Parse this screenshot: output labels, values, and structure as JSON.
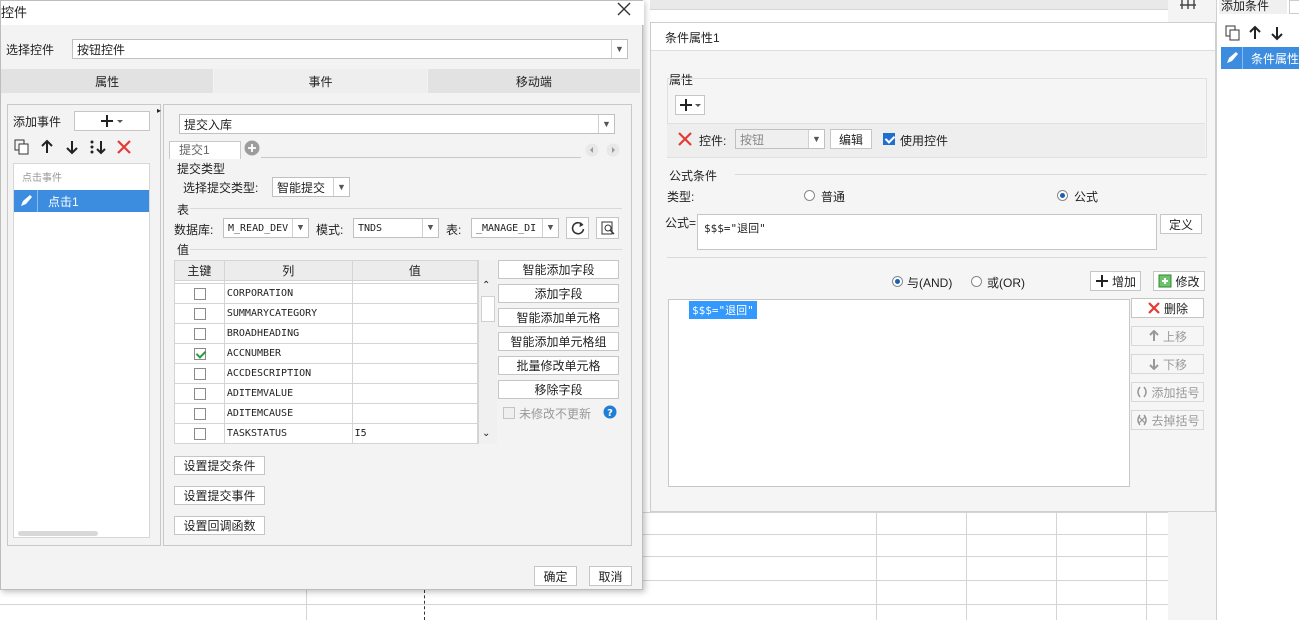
{
  "main_dialog": {
    "title": "控件",
    "select_label": "选择控件",
    "select_value": "按钮控件",
    "tabs": [
      "属性",
      "事件",
      "移动端"
    ],
    "active_tab": 1,
    "add_event_label": "添加事件",
    "event_group_label": "点击事件",
    "event_item": "点击1",
    "action_select": "提交入库",
    "submit_tab": "提交1",
    "submit_type_section": "提交类型",
    "submit_type_label": "选择提交类型:",
    "submit_type_value": "智能提交",
    "table_section": "表",
    "db_label": "数据库:",
    "db_value": "M_READ_DEV",
    "schema_label": "模式:",
    "schema_value": "TNDS",
    "table_label": "表:",
    "table_value": "_MANAGE_DI",
    "value_section": "值",
    "columns": [
      "主键",
      "列",
      "值"
    ],
    "rows": [
      {
        "key": false,
        "col": "CORPORATION",
        "val": ""
      },
      {
        "key": false,
        "col": "SUMMARYCATEGORY",
        "val": ""
      },
      {
        "key": false,
        "col": "BROADHEADING",
        "val": ""
      },
      {
        "key": true,
        "col": "ACCNUMBER",
        "val": ""
      },
      {
        "key": false,
        "col": "ACCDESCRIPTION",
        "val": ""
      },
      {
        "key": false,
        "col": "ADITEMVALUE",
        "val": ""
      },
      {
        "key": false,
        "col": "ADITEMCAUSE",
        "val": ""
      },
      {
        "key": false,
        "col": "TASKSTATUS",
        "val": "I5"
      }
    ],
    "side_buttons": [
      "智能添加字段",
      "添加字段",
      "智能添加单元格",
      "智能添加单元格组",
      "批量修改单元格",
      "移除字段"
    ],
    "no_update_label": "未修改不更新",
    "bottom_buttons": [
      "设置提交条件",
      "设置提交事件",
      "设置回调函数"
    ],
    "ok": "确定",
    "cancel": "取消"
  },
  "condition_dialog": {
    "title": "条件属性1",
    "attr_section": "属性",
    "control_label": "控件:",
    "control_value": "按钮",
    "edit_button": "编辑",
    "use_control_label": "使用控件",
    "formula_section": "公式条件",
    "type_label": "类型:",
    "type_normal": "普通",
    "type_formula": "公式",
    "formula_label": "公式=",
    "formula_value": "$$$=\"退回\"",
    "define_button": "定义",
    "and_label": "与(AND)",
    "or_label": "或(OR)",
    "add_button": "增加",
    "modify_button": "修改",
    "list_item": "$$$=\"退回\"",
    "list_buttons": [
      "删除",
      "上移",
      "下移",
      "添加括号",
      "去掉括号"
    ]
  },
  "right_panel": {
    "title": "添加条件",
    "item": "条件属性"
  },
  "colors": {
    "accent": "#3c8de0",
    "selection": "#3399ff",
    "danger": "#e53935"
  }
}
